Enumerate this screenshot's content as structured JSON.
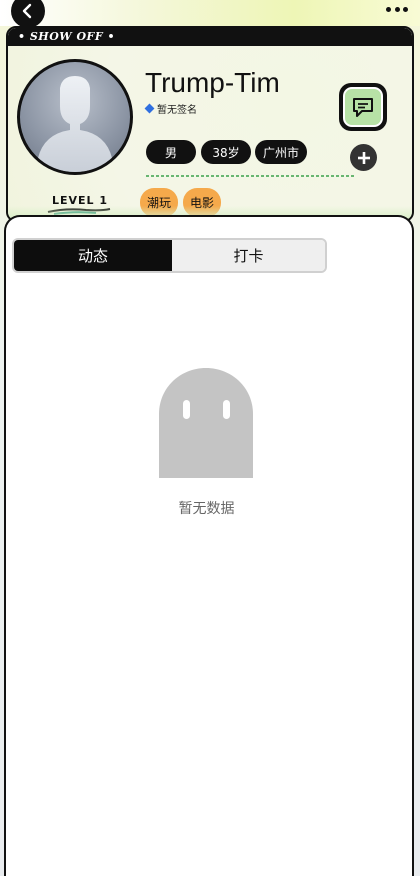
{
  "header": {
    "back_icon": "chevron-left-icon",
    "more_icon": "more-horizontal-icon"
  },
  "profile": {
    "banner_label": "• SHOW OFF •",
    "username": "Trump-Tim",
    "signature": "暂无签名",
    "level": "LEVEL 1",
    "chips": {
      "gender": "男",
      "age": "38岁",
      "city": "广州市"
    },
    "interests": [
      "潮玩",
      "电影"
    ],
    "chat_icon": "chat-bubble-icon",
    "add_icon": "plus-icon"
  },
  "tabs": [
    {
      "label": "动态",
      "active": true
    },
    {
      "label": "打卡",
      "active": false
    }
  ],
  "empty_state": {
    "text": "暂无数据",
    "icon": "empty-ghost-icon"
  },
  "colors": {
    "accent_black": "#111111",
    "tag_orange": "#f5a94b",
    "chat_green": "#b7e2a6",
    "diamond_blue": "#2f6fe0"
  }
}
